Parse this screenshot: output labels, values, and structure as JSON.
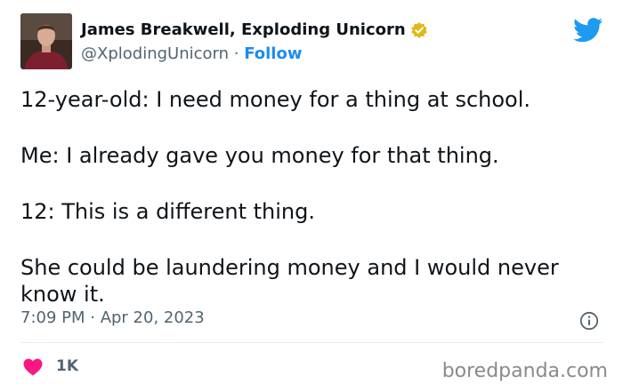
{
  "author": {
    "name": "James Breakwell, Exploding Unicorn",
    "handle": "@XplodingUnicorn",
    "separator": " · ",
    "follow_label": "Follow"
  },
  "tweet": {
    "lines": [
      "12-year-old: I need money for a thing at school.",
      "Me: I already gave you money for that thing.",
      "12: This is a different thing.",
      "She could be laundering money and I would never know it."
    ],
    "timestamp": "7:09 PM · Apr 20, 2023"
  },
  "engagement": {
    "like_count": "1K"
  },
  "watermark": "boredpanda.com",
  "icons": {
    "verified": "verified-badge-icon",
    "brand": "twitter-bird-icon",
    "info": "info-icon",
    "like": "heart-icon"
  },
  "colors": {
    "link": "#1d8bf0",
    "heart": "#f91880",
    "verified_badge": "#e2b719",
    "secondary_text": "#536471",
    "twitter_blue": "#1d9bf0"
  }
}
